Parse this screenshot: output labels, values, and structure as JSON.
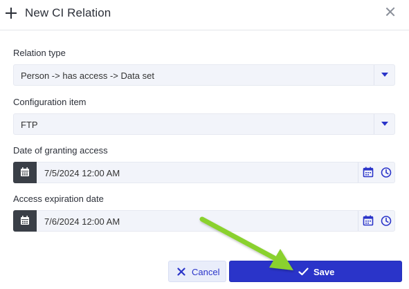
{
  "dialog": {
    "title": "New CI Relation"
  },
  "fields": {
    "relation_type": {
      "label": "Relation type",
      "value": "Person -> has access -> Data set"
    },
    "configuration_item": {
      "label": "Configuration item",
      "value": "FTP"
    },
    "grant_date": {
      "label": "Date of granting access",
      "value": "7/5/2024 12:00 AM"
    },
    "expiration_date": {
      "label": "Access expiration date",
      "value": "7/6/2024 12:00 AM"
    }
  },
  "footer": {
    "cancel_label": "Cancel",
    "save_label": "Save"
  },
  "colors": {
    "accent": "#2a34c9",
    "annotation_arrow": "#8ad12e",
    "field_bg": "#f2f4fa",
    "calendar_left_bg": "#3a3f47"
  },
  "icons": {
    "header": "plus-icon",
    "close": "close-icon",
    "dropdown": "chevron-down-icon",
    "calendar": "calendar-icon",
    "clock": "clock-icon",
    "cancel": "x-icon",
    "save": "check-icon"
  }
}
